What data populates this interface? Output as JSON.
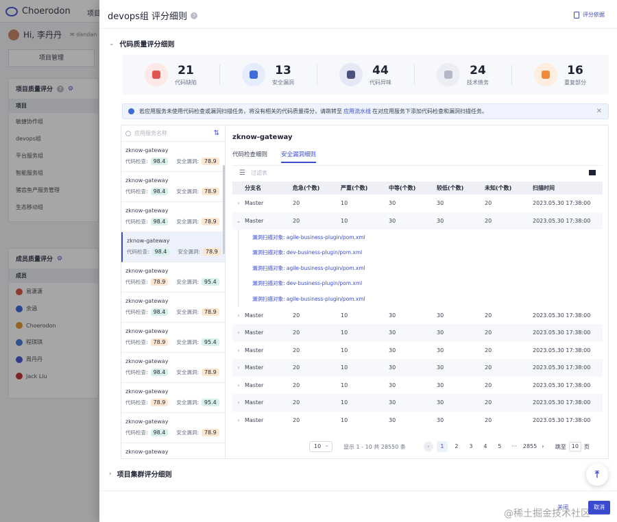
{
  "background": {
    "app_name": "Choerodon",
    "top_nav": "项目",
    "user_greeting": "Hi, 李丹丹",
    "user_mail": "dandan",
    "project_tab": "项目管理",
    "project_panel": {
      "title": "项目质量评分",
      "header": "项目",
      "rows": [
        "敏捷协作组",
        "devops组",
        "平台服务组",
        "智能服务组",
        "猪齿鱼产服务管理",
        "生态移动组"
      ]
    },
    "member_panel": {
      "title": "成员质量评分",
      "header": "成员",
      "rows": [
        {
          "name": "易潇潇",
          "color": "#d95c4a"
        },
        {
          "name": "余涵",
          "color": "#3f6bd8"
        },
        {
          "name": "Choerodon",
          "color": "#e59a3a"
        },
        {
          "name": "程琪琪",
          "color": "#4a7fd8"
        },
        {
          "name": "周丹丹",
          "color": "#4a5bd4"
        },
        {
          "name": "Jack Liu",
          "color": "#c43a3a"
        }
      ]
    }
  },
  "drawer": {
    "title": "devops组 评分细则",
    "score_basis": "评分依据",
    "section1": "代码质量评分细则",
    "section2": "项目集群评分细则",
    "stats": [
      {
        "value": "21",
        "label": "代码缺陷",
        "bg": "#fde8e8",
        "fg": "#e25555",
        "icon": "bug-icon"
      },
      {
        "value": "13",
        "label": "安全漏洞",
        "bg": "#e5ecfb",
        "fg": "#3f6bd8",
        "icon": "lock-icon"
      },
      {
        "value": "44",
        "label": "代码异味",
        "bg": "#e6e8f5",
        "fg": "#4a5080",
        "icon": "smell-icon"
      },
      {
        "value": "24",
        "label": "技术债务",
        "bg": "#eceef4",
        "fg": "#b3b7c8",
        "icon": "debt-icon"
      },
      {
        "value": "16",
        "label": "重复部分",
        "bg": "#fdeee0",
        "fg": "#f08a3a",
        "icon": "duplicate-icon"
      }
    ],
    "info": {
      "text_before": "若应用服务未使用代码检查或漏洞扫描任务，将没有相关的代码质量得分，请跳转至",
      "link": "应用流水线",
      "text_after": "在对应用服务下添加代码检查和漏洞扫描任务。"
    },
    "list": {
      "search_placeholder": "应用服务名称",
      "items": [
        {
          "name": "zknow-gateway",
          "code_label": "代码检查:",
          "code": "98.4",
          "sec_label": "安全漏洞:",
          "sec": "78.9",
          "code_color": "#d9efe9",
          "sec_color": "#fde6cf",
          "active": false
        },
        {
          "name": "zknow-gateway",
          "code_label": "代码检查:",
          "code": "98.4",
          "sec_label": "安全漏洞:",
          "sec": "78.9",
          "code_color": "#d9efe9",
          "sec_color": "#fde6cf",
          "active": false
        },
        {
          "name": "zknow-gateway",
          "code_label": "代码检查:",
          "code": "98.4",
          "sec_label": "安全漏洞:",
          "sec": "78.9",
          "code_color": "#d9efe9",
          "sec_color": "#fde6cf",
          "active": false
        },
        {
          "name": "zknow-gateway",
          "code_label": "代码检查:",
          "code": "98.4",
          "sec_label": "安全漏洞:",
          "sec": "78.9",
          "code_color": "#d9efe9",
          "sec_color": "#fde6cf",
          "active": true
        },
        {
          "name": "zknow-gateway",
          "code_label": "代码检查:",
          "code": "78.9",
          "sec_label": "安全漏洞:",
          "sec": "95.4",
          "code_color": "#fde6cf",
          "sec_color": "#d9efe9",
          "active": false
        },
        {
          "name": "zknow-gateway",
          "code_label": "代码检查:",
          "code": "98.4",
          "sec_label": "安全漏洞:",
          "sec": "78.9",
          "code_color": "#d9efe9",
          "sec_color": "#fde6cf",
          "active": false
        },
        {
          "name": "zknow-gateway",
          "code_label": "代码检查:",
          "code": "78.9",
          "sec_label": "安全漏洞:",
          "sec": "95.4",
          "code_color": "#fde6cf",
          "sec_color": "#d9efe9",
          "active": false
        },
        {
          "name": "zknow-gateway",
          "code_label": "代码检查:",
          "code": "98.4",
          "sec_label": "安全漏洞:",
          "sec": "78.9",
          "code_color": "#d9efe9",
          "sec_color": "#fde6cf",
          "active": false
        },
        {
          "name": "zknow-gateway",
          "code_label": "代码检查:",
          "code": "78.9",
          "sec_label": "安全漏洞:",
          "sec": "95.4",
          "code_color": "#fde6cf",
          "sec_color": "#d9efe9",
          "active": false
        },
        {
          "name": "zknow-gateway",
          "code_label": "代码检查:",
          "code": "98.4",
          "sec_label": "安全漏洞:",
          "sec": "78.9",
          "code_color": "#d9efe9",
          "sec_color": "#fde6cf",
          "active": false
        },
        {
          "name": "zknow-gateway",
          "code_label": "",
          "code": "",
          "sec_label": "",
          "sec": "",
          "code_color": "",
          "sec_color": "",
          "active": false
        }
      ]
    },
    "detail": {
      "title": "zknow-gateway",
      "tabs": [
        {
          "label": "代码检查细则",
          "active": false
        },
        {
          "label": "安全漏洞细则",
          "active": true
        }
      ],
      "filter_placeholder": "过滤表",
      "columns": [
        "分支名",
        "危急(个数)",
        "严重(个数)",
        "中等(个数)",
        "较低(个数)",
        "未知(个数)",
        "扫描时间"
      ],
      "rows_top": [
        {
          "expander": "›",
          "branch": "Master",
          "c1": "20",
          "c2": "10",
          "c3": "30",
          "c4": "30",
          "c5": "20",
          "time": "2023.05.30  17:38:00"
        },
        {
          "expander": "⌄",
          "branch": "Master",
          "c1": "20",
          "c2": "10",
          "c3": "30",
          "c4": "30",
          "c5": "20",
          "time": "2023.05.30  17:38:00"
        }
      ],
      "sub_rows": [
        "漏洞扫描对象: agile-business-plugin/pom.xml",
        "漏洞扫描对象: dev-business-plugin/pom.xml",
        "漏洞扫描对象: agile-business-plugin/pom.xml",
        "漏洞扫描对象: dev-business-plugin/pom.xml",
        "漏洞扫描对象: agile-business-plugin/pom.xml"
      ],
      "rows_bottom": [
        {
          "expander": "›",
          "branch": "Master",
          "c1": "20",
          "c2": "10",
          "c3": "30",
          "c4": "30",
          "c5": "20",
          "time": "2023.05.30  17:38:00"
        },
        {
          "expander": "›",
          "branch": "Master",
          "c1": "20",
          "c2": "10",
          "c3": "30",
          "c4": "30",
          "c5": "20",
          "time": "2023.05.30  17:38:00"
        },
        {
          "expander": "›",
          "branch": "Master",
          "c1": "20",
          "c2": "10",
          "c3": "30",
          "c4": "30",
          "c5": "20",
          "time": "2023.05.30  17:38:00"
        },
        {
          "expander": "›",
          "branch": "Master",
          "c1": "20",
          "c2": "10",
          "c3": "30",
          "c4": "30",
          "c5": "20",
          "time": "2023.05.30  17:38:00"
        },
        {
          "expander": "›",
          "branch": "Master",
          "c1": "20",
          "c2": "10",
          "c3": "30",
          "c4": "30",
          "c5": "20",
          "time": "2023.05.30  17:38:00"
        },
        {
          "expander": "›",
          "branch": "Master",
          "c1": "20",
          "c2": "10",
          "c3": "30",
          "c4": "30",
          "c5": "20",
          "time": "2023.05.30  17:38:00"
        },
        {
          "expander": "›",
          "branch": "Master",
          "c1": "20",
          "c2": "10",
          "c3": "30",
          "c4": "30",
          "c5": "20",
          "time": "2023.05.30  17:38:00"
        }
      ],
      "pager": {
        "page_size": "10",
        "total_text": "显示 1 - 10 共 28550 条",
        "pages": [
          "1",
          "2",
          "3",
          "4",
          "5",
          "···",
          "2855"
        ],
        "current": "1",
        "goto_label": "跳至",
        "goto_value": "10",
        "goto_unit": "页"
      }
    },
    "footer": {
      "cancel": "关闭",
      "ok": "取消"
    },
    "watermark": "@稀土掘金技术社区"
  }
}
